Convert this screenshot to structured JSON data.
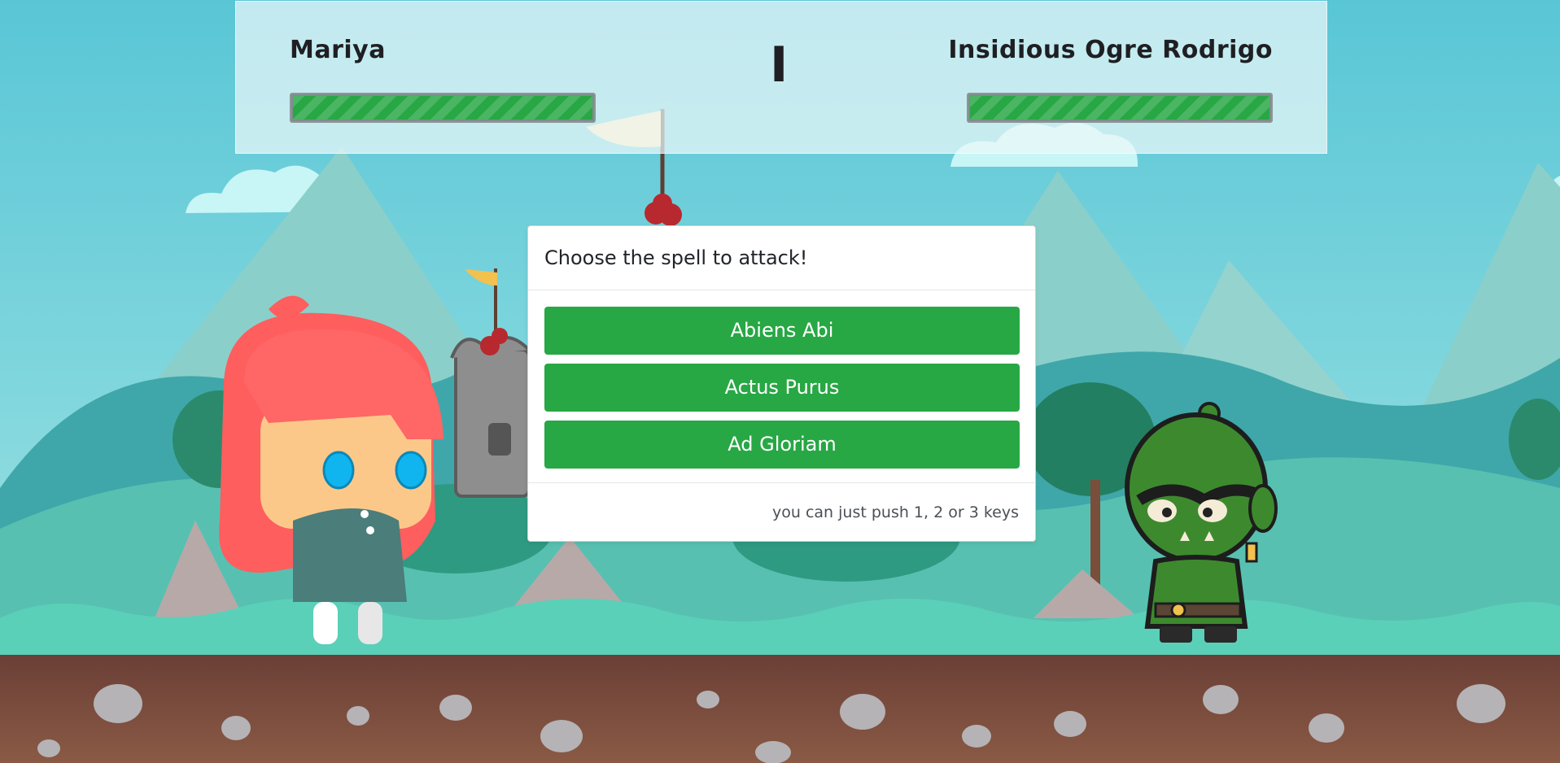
{
  "players": {
    "left": {
      "name": "Mariya",
      "health": 1.0
    },
    "right": {
      "name": "Insidious Ogre Rodrigo",
      "health": 1.0
    }
  },
  "turn_indicator": "I",
  "spell_card": {
    "title": "Choose the spell to attack!",
    "spells": [
      "Abiens Abi",
      "Actus Purus",
      "Ad Gloriam"
    ],
    "hint": "you can just push 1, 2 or 3 keys"
  },
  "colors": {
    "sky": "#6ccfd8",
    "button": "#28a745",
    "hero_hair": "#ff5e5e",
    "ogre_skin": "#3d8a2e"
  }
}
